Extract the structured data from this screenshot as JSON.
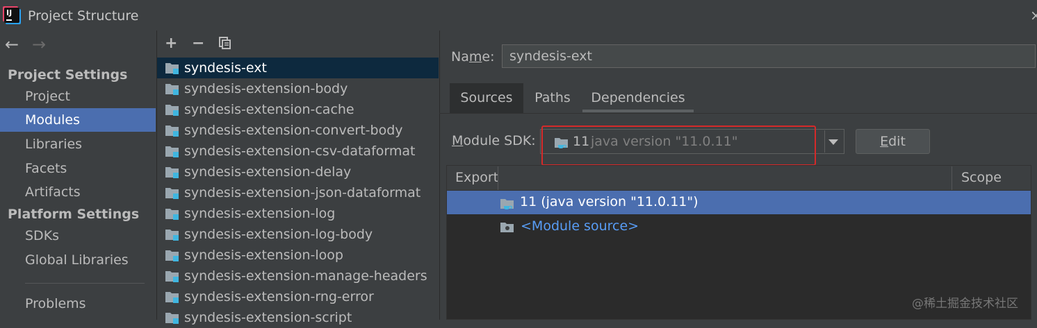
{
  "window": {
    "title": "Project Structure",
    "close_glyph": "×"
  },
  "nav": {
    "back_glyph": "←",
    "forward_glyph": "→",
    "project_settings_header": "Project Settings",
    "project_settings_items": [
      "Project",
      "Modules",
      "Libraries",
      "Facets",
      "Artifacts"
    ],
    "platform_settings_header": "Platform Settings",
    "platform_settings_items": [
      "SDKs",
      "Global Libraries"
    ],
    "problems": "Problems",
    "selected": "Modules"
  },
  "modules_toolbar": {
    "add_glyph": "+",
    "remove_glyph": "−",
    "copy_icon": "copy-icon"
  },
  "modules": [
    "syndesis-ext",
    "syndesis-extension-body",
    "syndesis-extension-cache",
    "syndesis-extension-convert-body",
    "syndesis-extension-csv-dataformat",
    "syndesis-extension-delay",
    "syndesis-extension-json-dataformat",
    "syndesis-extension-log",
    "syndesis-extension-log-body",
    "syndesis-extension-loop",
    "syndesis-extension-manage-headers",
    "syndesis-extension-rng-error",
    "syndesis-extension-script"
  ],
  "selected_module": "syndesis-ext",
  "detail": {
    "name_label_pre": "Na",
    "name_label_mnemonic": "m",
    "name_label_post": "e:",
    "name_value": "syndesis-ext",
    "tabs": [
      "Sources",
      "Paths",
      "Dependencies"
    ],
    "active_tab": "Dependencies",
    "sdk_label_mnemonic": "M",
    "sdk_label_rest": "odule SDK:",
    "sdk_version": "11",
    "sdk_detail": "java version \"11.0.11\"",
    "edit_mnemonic": "E",
    "edit_rest": "dit"
  },
  "dependencies": {
    "columns": [
      "Export",
      "Scope"
    ],
    "rows": [
      {
        "label": "11 (java version \"11.0.11\")",
        "icon": "jdk-folder-icon",
        "selected": true
      },
      {
        "label": "<Module source>",
        "icon": "source-folder-icon",
        "selected": false
      }
    ]
  },
  "watermark": "@稀土掘金技术社区",
  "colors": {
    "background": "#3c3f41",
    "selection": "#4b6eaf",
    "module_selection": "#0d293e",
    "highlight_box": "#d52a2a",
    "link_blue": "#589df6"
  }
}
